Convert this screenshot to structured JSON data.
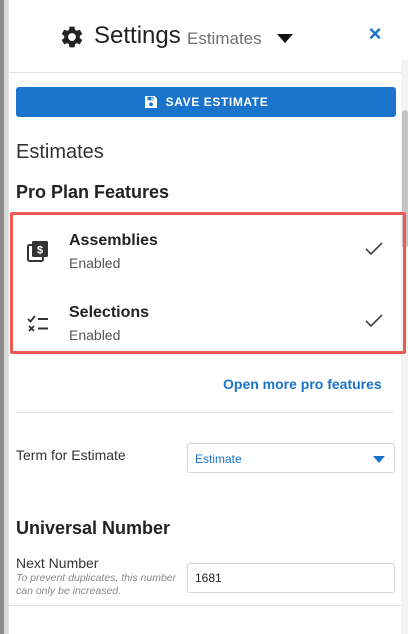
{
  "header": {
    "title": "Settings",
    "subtitle": "Estimates",
    "close_label": "×"
  },
  "toolbar": {
    "save_label": "SAVE ESTIMATE"
  },
  "section": {
    "title": "Estimates"
  },
  "pro_features": {
    "title": "Pro Plan Features",
    "items": [
      {
        "name": "Assemblies",
        "status": "Enabled",
        "icon": "assemblies-icon",
        "checked": true
      },
      {
        "name": "Selections",
        "status": "Enabled",
        "icon": "selections-icon",
        "checked": true
      }
    ],
    "more_link": "Open more pro features"
  },
  "term": {
    "label": "Term for Estimate",
    "selected": "Estimate"
  },
  "universal_number": {
    "title": "Universal Number",
    "next_label": "Next Number",
    "help_text": "To prevent duplicates, this number can only be increased.",
    "value": "1681"
  },
  "colors": {
    "accent": "#1a74cc",
    "highlight_border": "#ee5a4f"
  }
}
